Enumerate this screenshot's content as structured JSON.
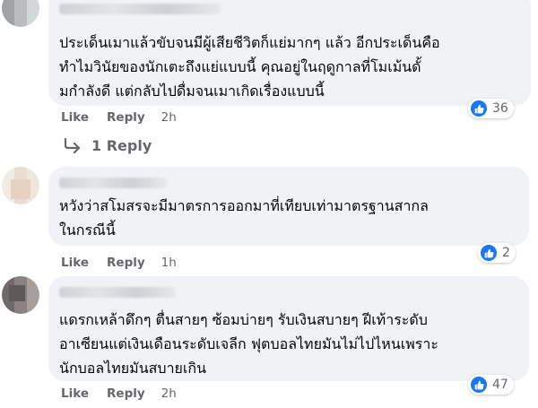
{
  "comments": [
    {
      "text": "ประเด็นเมาแล้วขับจนมีผู้เสียชีวิตก็แย่มากๆ แล้ว อีกประเด็นคือ\nทำไมวินัยของนักเตะถึงแย่แบบนี้ คุณอยู่ในฤดูกาลที่โมเม้นดั้\nมกำลังดี แต่กลับไปดื่มจนเมาเกิดเรื่องแบบนี้",
      "like_label": "Like",
      "reply_label": "Reply",
      "time": "2h",
      "reaction_count": "36"
    },
    {
      "text": "หวังว่าสโมสรจะมีมาตรการออกมาที่เทียบเท่ามาตรฐานสากล\nในกรณีนี้",
      "like_label": "Like",
      "reply_label": "Reply",
      "time": "1h",
      "reaction_count": "2"
    },
    {
      "text": "แดรกเหล้าดึกๆ ตื่นสายๆ ซ้อมบ่ายๆ รับเงินสบายๆ ฝีเท้าระดับ\nอาเซียนแต่เงินเดือนระดับเจลีก ฟุตบอลไทยมันไม่ไปไหนเพราะ\nนักบอลไทยมันสบายเกิน",
      "like_label": "Like",
      "reply_label": "Reply",
      "time": "2h",
      "reaction_count": "47"
    }
  ],
  "view_replies_label": "1 Reply",
  "colors": {
    "bubble": "#f0f2f5",
    "meta_text": "#65676b",
    "like_blue": "#1877f2"
  },
  "icons": {
    "reaction": "thumbs-up-icon",
    "reply_arrow": "reply-arrow-icon"
  }
}
